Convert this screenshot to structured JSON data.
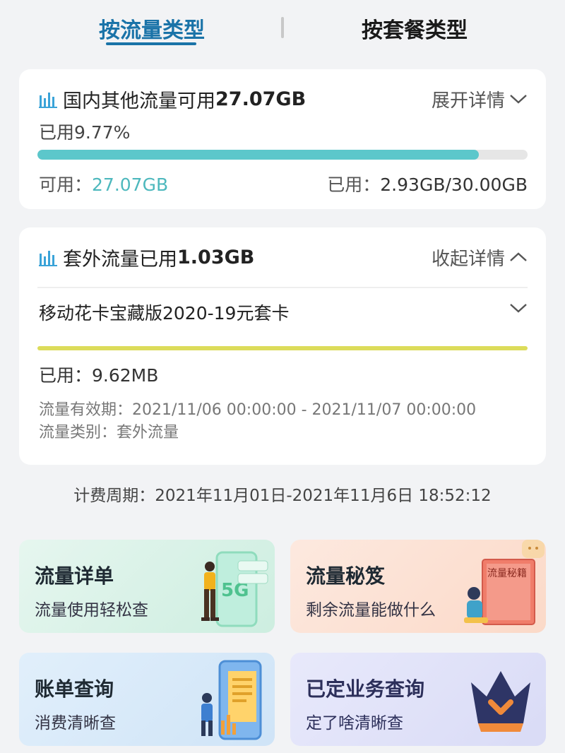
{
  "tabs": {
    "by_traffic_type": "按流量类型",
    "by_package_type": "按套餐类型"
  },
  "domestic_card": {
    "title_prefix": "国内其他流量可用",
    "title_value": "27.07GB",
    "toggle_label": "展开详情",
    "used_percent_text": "已用9.77%",
    "used_fraction": 0.9,
    "available_label": "可用：",
    "available_value": "27.07GB",
    "used_label": "已用：",
    "used_value": "2.93GB/30.00GB"
  },
  "extra_card": {
    "title_prefix": "套外流量已用",
    "title_value": "1.03GB",
    "toggle_label": "收起详情",
    "plan_name": "移动花卡宝藏版2020-19元套卡",
    "used_label": "已用：",
    "used_value": "9.62MB",
    "validity_text": "流量有效期：2021/11/06 00:00:00 - 2021/11/07 00:00:00",
    "category_text": "流量类别：套外流量"
  },
  "billing_period": "计费周期：2021年11月01日-2021年11月6日 18:52:12",
  "tiles": [
    {
      "title": "流量详单",
      "subtitle": "流量使用轻松查"
    },
    {
      "title": "流量秘笈",
      "subtitle": "剩余流量能做什么",
      "book_text": "流量秘籍"
    },
    {
      "title": "账单查询",
      "subtitle": "消费清晰查"
    },
    {
      "title": "已定业务查询",
      "subtitle": "定了啥清晰查"
    }
  ],
  "colors": {
    "accent": "#1a73a8",
    "teal": "#5cc7cb",
    "yellow": "#dcdc5a"
  },
  "icons": [
    "bar-chart-icon",
    "chevron-down-icon",
    "chevron-up-icon"
  ]
}
